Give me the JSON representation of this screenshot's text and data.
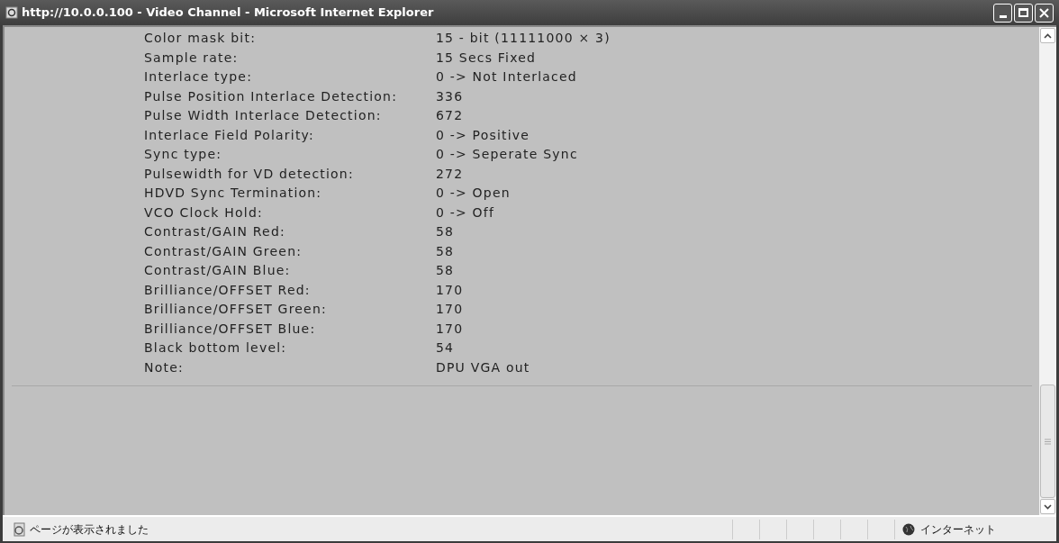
{
  "window": {
    "title": "http://10.0.0.100 - Video Channel - Microsoft Internet Explorer"
  },
  "rows": [
    {
      "label": "Color mask bit:",
      "value": "15 - bit (11111000 × 3)"
    },
    {
      "label": "Sample rate:",
      "value": "15 Secs Fixed"
    },
    {
      "label": "Interlace type:",
      "value": "0 -> Not Interlaced"
    },
    {
      "label": "Pulse Position Interlace Detection:",
      "value": "336"
    },
    {
      "label": "Pulse Width Interlace Detection:",
      "value": "672"
    },
    {
      "label": "Interlace Field Polarity:",
      "value": "0 -> Positive"
    },
    {
      "label": "Sync type:",
      "value": "0 -> Seperate Sync"
    },
    {
      "label": "Pulsewidth for VD detection:",
      "value": "272"
    },
    {
      "label": "HDVD Sync Termination:",
      "value": "0 -> Open"
    },
    {
      "label": "VCO Clock Hold:",
      "value": "0 -> Off"
    },
    {
      "label": "Contrast/GAIN Red:",
      "value": "58"
    },
    {
      "label": "Contrast/GAIN Green:",
      "value": "58"
    },
    {
      "label": "Contrast/GAIN Blue:",
      "value": "58"
    },
    {
      "label": "Brilliance/OFFSET Red:",
      "value": "170"
    },
    {
      "label": "Brilliance/OFFSET Green:",
      "value": "170"
    },
    {
      "label": "Brilliance/OFFSET Blue:",
      "value": "170"
    },
    {
      "label": "Black bottom level:",
      "value": "54"
    },
    {
      "label": "Note:",
      "value": "DPU VGA out"
    }
  ],
  "status_bar": {
    "message": "ページが表示されました",
    "zone": "インターネット"
  }
}
